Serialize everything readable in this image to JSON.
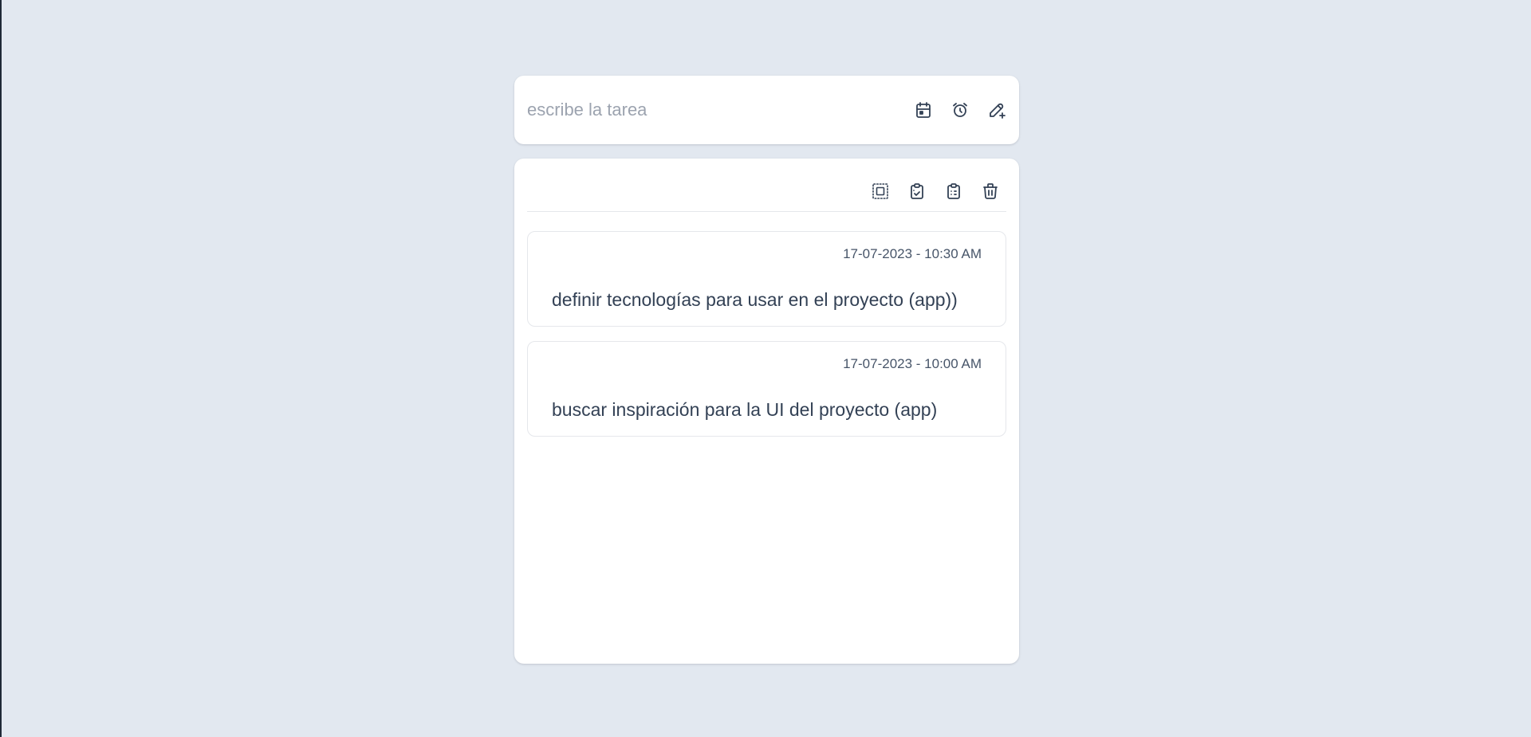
{
  "new_task": {
    "placeholder": "escribe la tarea",
    "value": "",
    "icons": [
      "calendar-icon",
      "alarm-clock-icon",
      "pencil-plus-icon"
    ]
  },
  "toolbar": {
    "icons": [
      "select-all-icon",
      "clipboard-check-icon",
      "clipboard-list-icon",
      "trash-icon"
    ]
  },
  "tasks": [
    {
      "date": "17-07-2023 - 10:30 AM",
      "text": "definir tecnologías para usar en el proyecto (app))"
    },
    {
      "date": "17-07-2023 - 10:00 AM",
      "text": "buscar inspiración para la UI del proyecto (app)"
    }
  ],
  "colors": {
    "background": "#e2e8f0",
    "card": "#ffffff",
    "text": "#334155",
    "muted": "#9ca3af",
    "border": "#e5e7eb"
  }
}
